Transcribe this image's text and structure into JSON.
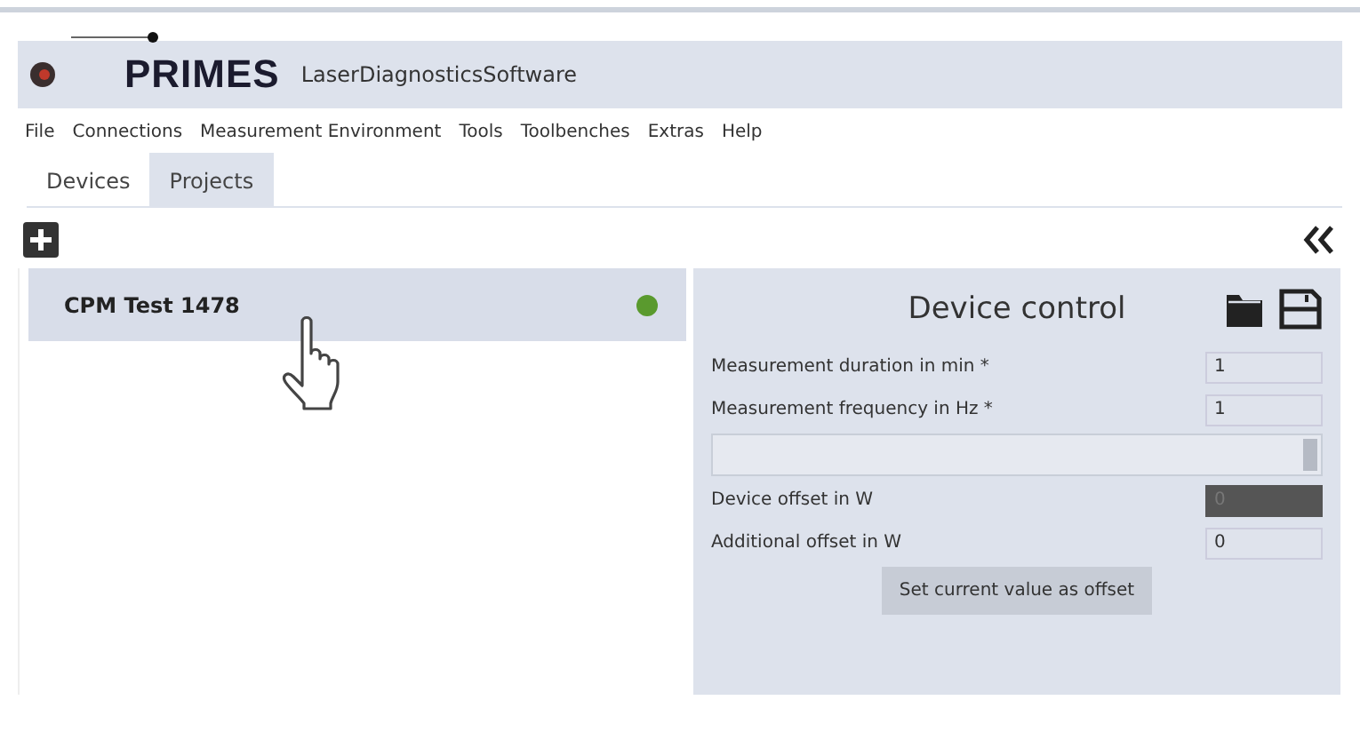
{
  "window": {
    "brand": "PRIMES",
    "title": "LaserDiagnosticsSoftware"
  },
  "menu": [
    "File",
    "Connections",
    "Measurement Environment",
    "Tools",
    "Toolbenches",
    "Extras",
    "Help"
  ],
  "tabs": [
    {
      "label": "Devices",
      "selected": true
    },
    {
      "label": "Projects",
      "selected": false
    }
  ],
  "devices": [
    {
      "name": "CPM Test 1478",
      "selected": true,
      "color": "#5a9a2e"
    }
  ],
  "device_control": {
    "title": "Device control",
    "fields": [
      {
        "kind": "input",
        "label": "Measurement duration in min *",
        "value": "1",
        "disabled": false
      },
      {
        "kind": "input",
        "label": "Measurement frequency in Hz *",
        "value": "1",
        "disabled": false
      },
      {
        "kind": "wide"
      },
      {
        "kind": "input",
        "label": "Device offset in W",
        "value": "0",
        "disabled": true
      },
      {
        "kind": "input",
        "label": "Additional offset in W",
        "value": "0",
        "disabled": false
      }
    ],
    "button": "Set current value as offset"
  }
}
